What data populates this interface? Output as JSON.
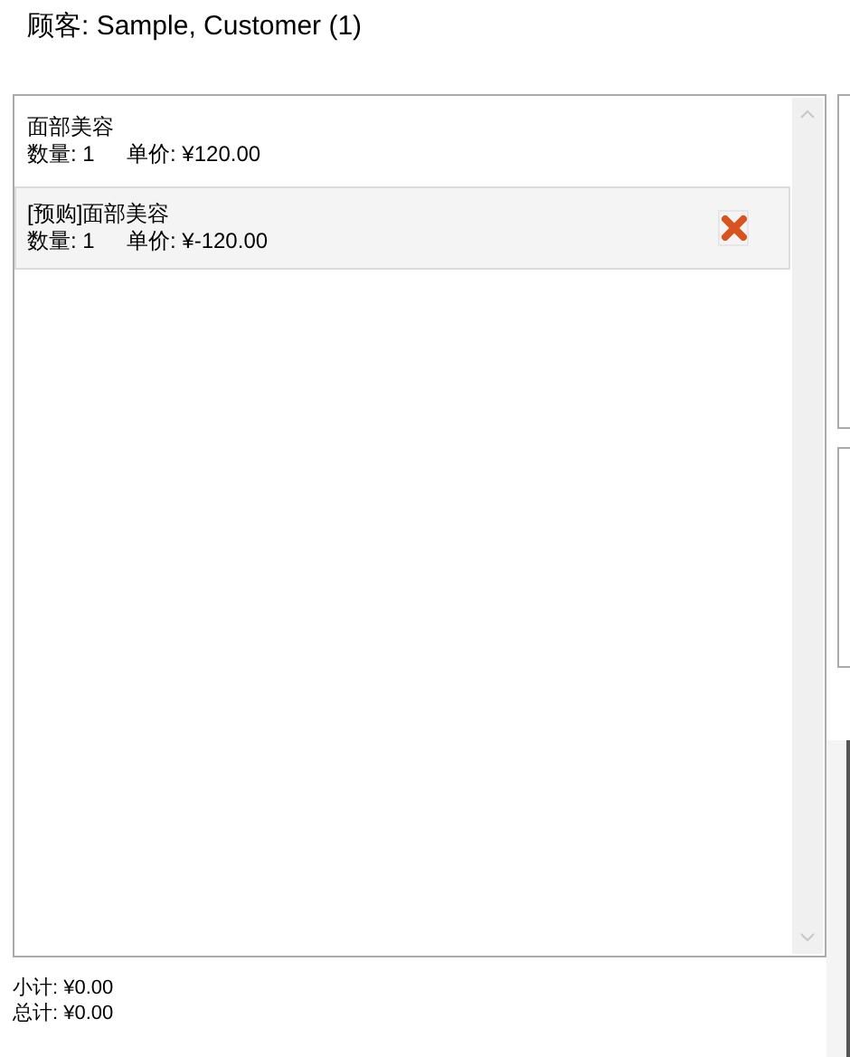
{
  "customer": {
    "label": "顾客: Sample, Customer (1)"
  },
  "items": [
    {
      "name": "面部美容",
      "quantity": "数量: 1",
      "price": "单价: ¥120.00",
      "selected": false
    },
    {
      "name": "[预购]面部美容",
      "quantity": "数量: 1",
      "price": "单价: ¥-120.00",
      "selected": true
    }
  ],
  "summary": {
    "subtotal": "小计: ¥0.00",
    "total": "总计: ¥0.00"
  }
}
